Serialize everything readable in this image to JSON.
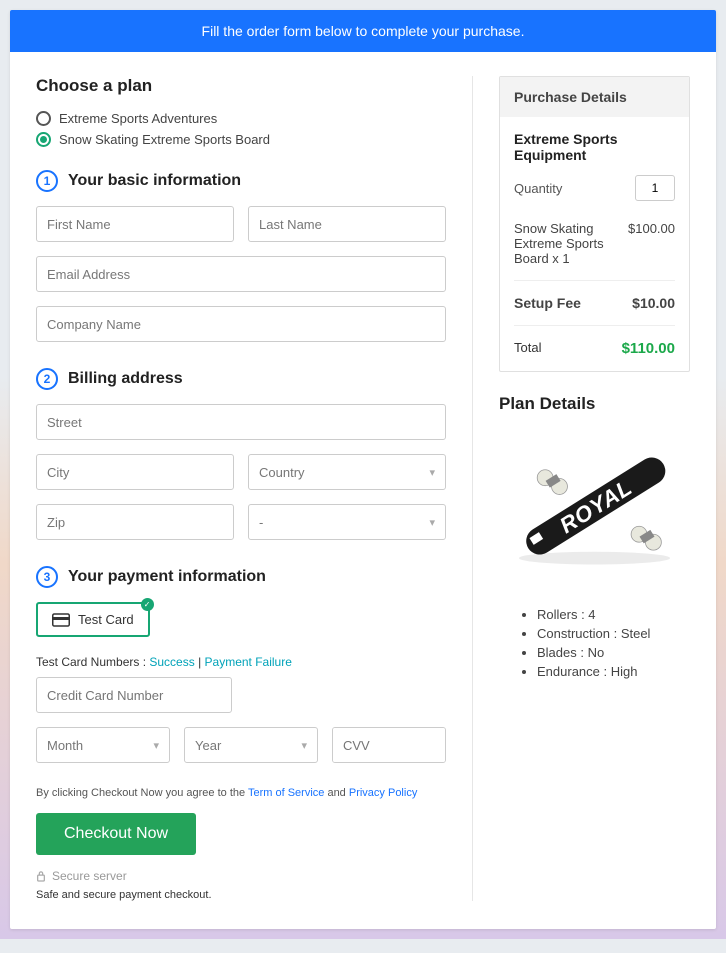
{
  "banner": {
    "text": "Fill the order form below to complete your purchase."
  },
  "plan_section": {
    "title": "Choose a plan",
    "options": [
      {
        "label": "Extreme Sports Adventures",
        "selected": false
      },
      {
        "label": "Snow Skating Extreme Sports Board",
        "selected": true
      }
    ]
  },
  "step1": {
    "num": "1",
    "title": "Your basic information",
    "first_name_ph": "First Name",
    "last_name_ph": "Last Name",
    "email_ph": "Email Address",
    "company_ph": "Company Name"
  },
  "step2": {
    "num": "2",
    "title": "Billing address",
    "street_ph": "Street",
    "city_ph": "City",
    "country_ph": "Country",
    "zip_ph": "Zip",
    "state_ph": "-"
  },
  "step3": {
    "num": "3",
    "title": "Your payment information",
    "card_label": "Test Card",
    "test_card_prefix": "Test Card Numbers : ",
    "success_link": "Success",
    "separator": " | ",
    "failure_link": "Payment Failure",
    "cc_ph": "Credit Card Number",
    "month_ph": "Month",
    "year_ph": "Year",
    "cvv_ph": "CVV"
  },
  "terms": {
    "prefix": "By clicking Checkout Now you agree to the ",
    "tos": "Term of Service",
    "and": " and ",
    "privacy": "Privacy Policy"
  },
  "checkout_btn": "Checkout Now",
  "secure": {
    "server": "Secure server",
    "safe": "Safe and secure payment checkout."
  },
  "purchase_details": {
    "header": "Purchase Details",
    "product_title": "Extreme Sports Equipment",
    "qty_label": "Quantity",
    "qty_value": "1",
    "item_label": "Snow Skating Extreme Sports Board x 1",
    "item_price": "$100.00",
    "setup_label": "Setup Fee",
    "setup_price": "$10.00",
    "total_label": "Total",
    "total_price": "$110.00"
  },
  "plan_details": {
    "title": "Plan Details",
    "features": [
      "Rollers : 4",
      "Construction : Steel",
      "Blades : No",
      "Endurance : High"
    ]
  }
}
